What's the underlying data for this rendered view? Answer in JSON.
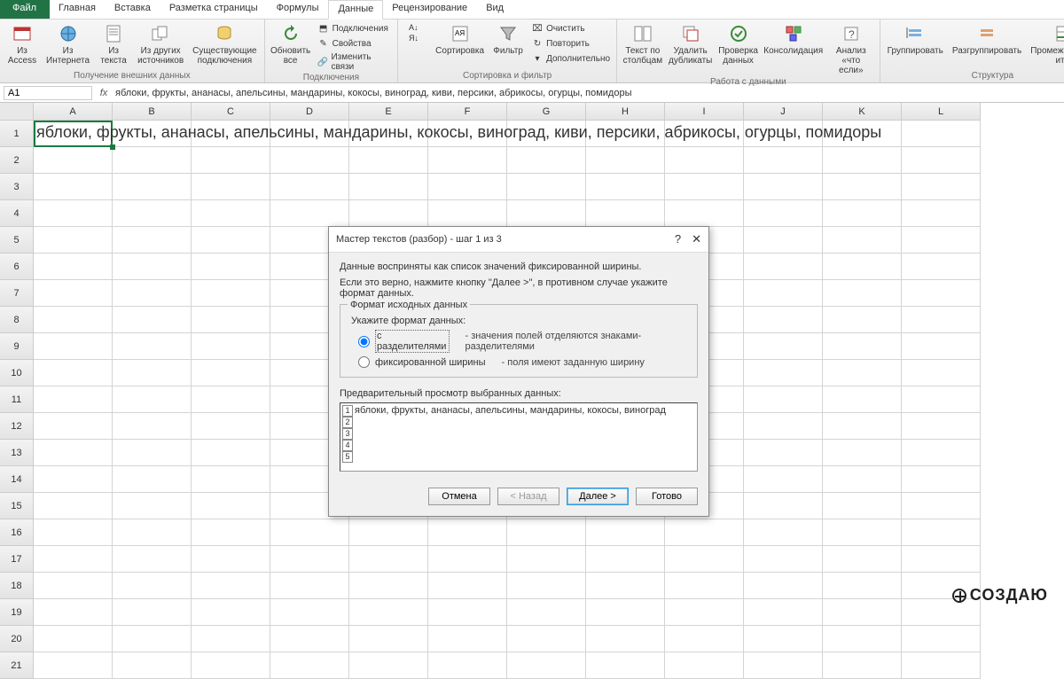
{
  "tabs": {
    "file": "Файл",
    "home": "Главная",
    "insert": "Вставка",
    "layout": "Разметка страницы",
    "formulas": "Формулы",
    "data": "Данные",
    "review": "Рецензирование",
    "view": "Вид"
  },
  "ribbon": {
    "ext": {
      "access": "Из\nAccess",
      "web": "Из\nИнтернета",
      "text": "Из\nтекста",
      "other": "Из других\nисточников",
      "existing": "Существующие\nподключения",
      "group": "Получение внешних данных"
    },
    "conn": {
      "refresh": "Обновить\nвсе",
      "connections": "Подключения",
      "properties": "Свойства",
      "editlinks": "Изменить связи",
      "group": "Подключения"
    },
    "sort": {
      "sort": "Сортировка",
      "filter": "Фильтр",
      "clear": "Очистить",
      "reapply": "Повторить",
      "advanced": "Дополнительно",
      "group": "Сортировка и фильтр"
    },
    "tools": {
      "ttc": "Текст по\nстолбцам",
      "dup": "Удалить\nдубликаты",
      "valid": "Проверка\nданных",
      "cons": "Консолидация",
      "whatif": "Анализ\n«что если»",
      "group": "Работа с данными"
    },
    "outline": {
      "group": "Группировать",
      "ungroup": "Разгруппировать",
      "subtotal": "Промежуточный\nитог",
      "label": "Структура"
    }
  },
  "formula": {
    "name": "A1",
    "value": "яблоки, фрукты, ананасы, апельсины, мандарины, кокосы, виноград, киви, персики, абрикосы, огурцы, помидоры"
  },
  "columns": [
    "A",
    "B",
    "C",
    "D",
    "E",
    "F",
    "G",
    "H",
    "I",
    "J",
    "K",
    "L"
  ],
  "rowcount": 21,
  "cellA1": "яблоки, фрукты, ананасы, апельсины, мандарины, кокосы, виноград, киви, персики, абрикосы, огурцы, помидоры",
  "dialog": {
    "title": "Мастер текстов (разбор) - шаг 1 из 3",
    "line1": "Данные восприняты как список значений фиксированной ширины.",
    "line2": "Если это верно, нажмите кнопку \"Далее >\", в противном случае укажите формат данных.",
    "fieldset": "Формат исходных данных",
    "specify": "Укажите формат данных:",
    "opt1": "с разделителями",
    "opt1desc": "- значения полей отделяются знаками-разделителями",
    "opt2": "фиксированной ширины",
    "opt2desc": "- поля имеют заданную ширину",
    "previewLabel": "Предварительный просмотр выбранных данных:",
    "previewText": "яблоки, фрукты, ананасы, апельсины, мандарины, кокосы, виноград",
    "cancel": "Отмена",
    "back": "< Назад",
    "next": "Далее >",
    "finish": "Готово"
  },
  "watermark": "СОЗДАЮ"
}
